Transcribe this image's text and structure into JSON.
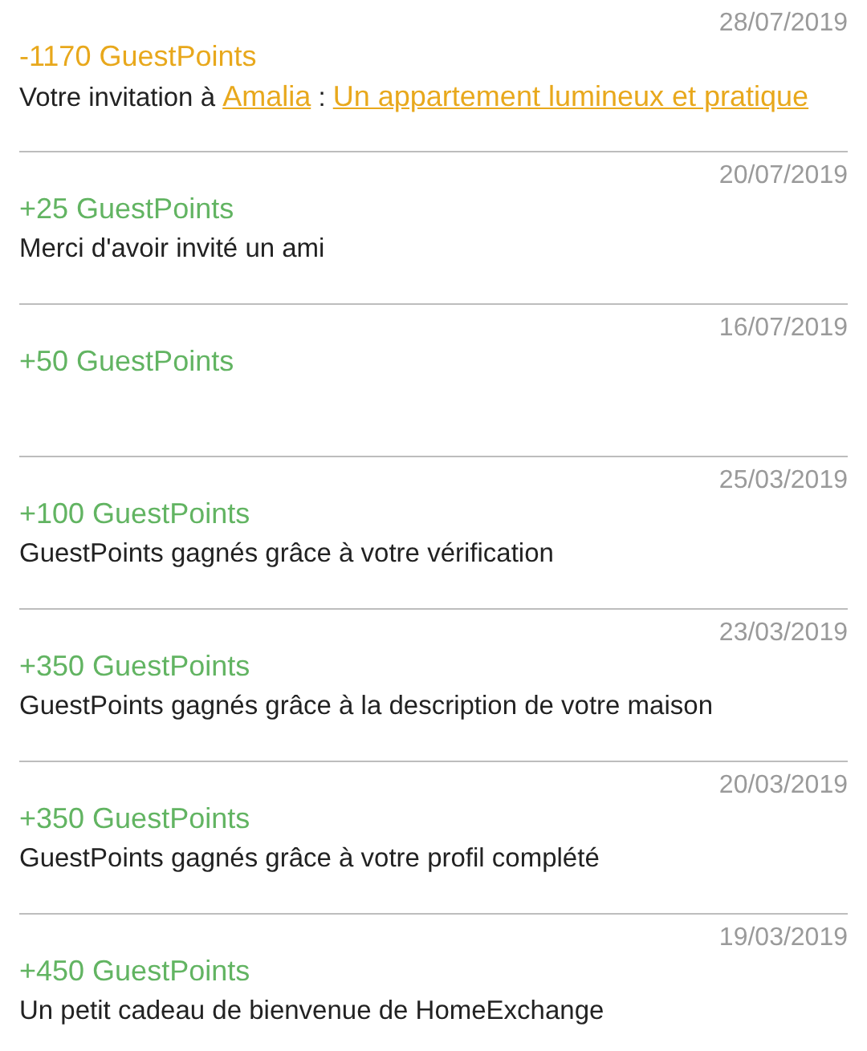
{
  "transactions": [
    {
      "date": "28/07/2019",
      "points": "-1170 GuestPoints",
      "kind": "debit",
      "description": [
        {
          "text": "Votre invitation à ",
          "link": false
        },
        {
          "text": "Amalia",
          "link": true
        },
        {
          "text": " : ",
          "link": false
        },
        {
          "text": "Un appartement lumineux et pratique",
          "link": true
        }
      ]
    },
    {
      "date": "20/07/2019",
      "points": "+25 GuestPoints",
      "kind": "credit",
      "description": [
        {
          "text": "Merci d'avoir invité un ami",
          "link": false
        }
      ]
    },
    {
      "date": "16/07/2019",
      "points": "+50 GuestPoints",
      "kind": "credit"
    },
    {
      "date": "25/03/2019",
      "points": "+100 GuestPoints",
      "kind": "credit",
      "description": [
        {
          "text": "GuestPoints gagnés grâce à votre vérification",
          "link": false
        }
      ]
    },
    {
      "date": "23/03/2019",
      "points": "+350 GuestPoints",
      "kind": "credit",
      "description": [
        {
          "text": "GuestPoints gagnés grâce à la description de votre maison",
          "link": false
        }
      ]
    },
    {
      "date": "20/03/2019",
      "points": "+350 GuestPoints",
      "kind": "credit",
      "description": [
        {
          "text": "GuestPoints gagnés grâce à votre profil complété",
          "link": false
        }
      ]
    },
    {
      "date": "19/03/2019",
      "points": "+450 GuestPoints",
      "kind": "credit",
      "description": [
        {
          "text": "Un petit cadeau de bienvenue de HomeExchange",
          "link": false
        }
      ]
    }
  ]
}
